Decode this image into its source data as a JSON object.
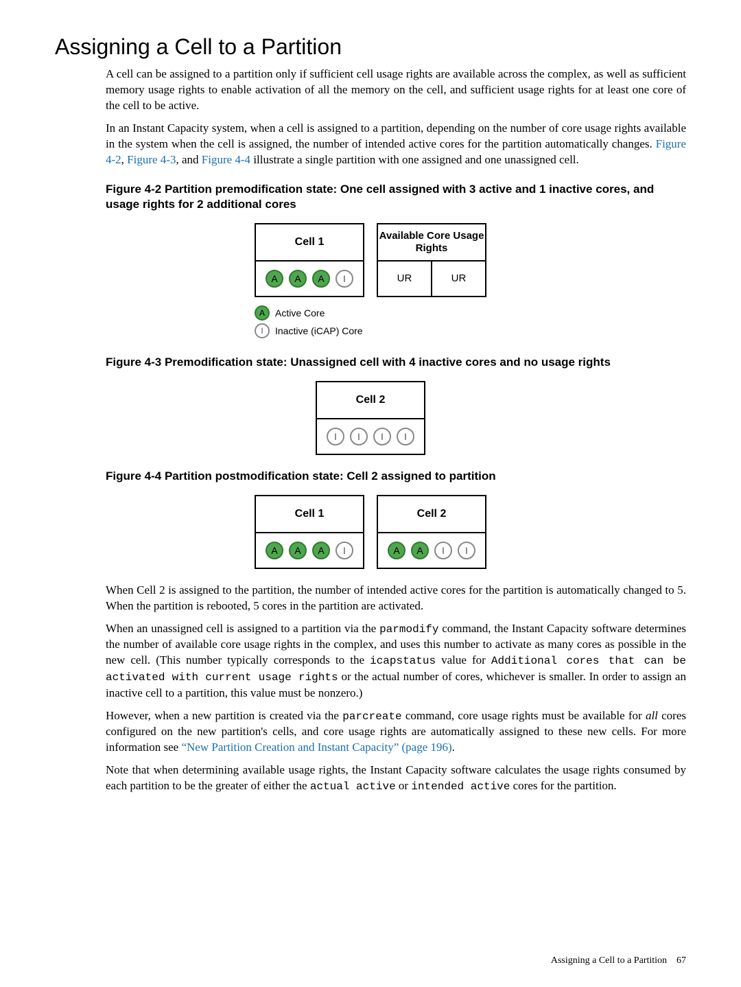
{
  "title": "Assigning a Cell to a Partition",
  "para1": "A cell can be assigned to a partition only if sufficient cell usage rights are available across the complex, as well as sufficient memory usage rights to enable activation of all the memory on the cell, and sufficient usage rights for at least one core of the cell to be active.",
  "para2a": "In an Instant Capacity system, when a cell is assigned to a partition, depending on the number of core usage rights available in the system when the cell is assigned, the number of intended active cores for the partition automatically changes. ",
  "link42": "Figure 4-2",
  "comma1": ", ",
  "link43": "Figure 4-3",
  "comma2": ", and ",
  "link44": "Figure 4-4",
  "para2b": " illustrate a single partition with one assigned and one unassigned cell.",
  "fig42_caption": "Figure 4-2 Partition premodification state: One cell assigned with 3 active and 1 inactive cores, and usage rights for 2 additional cores",
  "fig43_caption": "Figure 4-3 Premodification state: Unassigned cell with 4 inactive cores and no usage rights",
  "fig44_caption": "Figure 4-4 Partition postmodification state: Cell 2 assigned to partition",
  "cell1_label": "Cell 1",
  "cell2_label": "Cell 2",
  "rights_label": "Available Core Usage Rights",
  "ur": "UR",
  "coreA": "A",
  "coreI": "I",
  "legend_active": "Active Core",
  "legend_inactive": "Inactive (iCAP) Core",
  "para3": "When Cell 2 is assigned to the partition, the number of intended active cores for the partition is automatically changed to 5. When the partition is rebooted, 5 cores in the partition are activated.",
  "para4a": "When an unassigned cell is assigned to a partition via the ",
  "cmd_parmodify": "parmodify",
  "para4b": " command, the Instant Capacity software determines the number of available core usage rights in the complex, and uses this number to activate as many cores as possible in the new cell. (This number typically corresponds to the ",
  "cmd_icapstatus": "icapstatus",
  "para4c": " value for ",
  "cmd_additional": "Additional cores that can be activated with current usage rights",
  "para4d": " or the actual number of cores, whichever is smaller. In order to assign an inactive cell to a partition, this value must be nonzero.)",
  "para5a": "However, when a new partition is created via the ",
  "cmd_parcreate": "parcreate",
  "para5b": " command, core usage rights must be available for ",
  "para5_all": "all",
  "para5c": " cores configured on the new partition's cells, and core usage rights are automatically assigned to these new cells. For more information see ",
  "link_npc": "“New Partition Creation and Instant Capacity” (page 196)",
  "para5d": ".",
  "para6a": "Note that when determining available usage rights, the Instant Capacity software calculates the usage rights consumed by each partition to be the greater of either the ",
  "cmd_actual": "actual active",
  "para6b": " or ",
  "cmd_intended": "intended active",
  "para6c": " cores for the partition.",
  "footer_text": "Assigning a Cell to a Partition",
  "footer_page": "67"
}
